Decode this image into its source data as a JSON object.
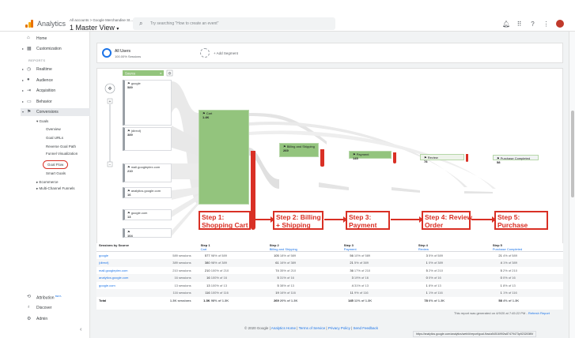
{
  "header": {
    "app_name": "Analytics",
    "breadcrumb": "All accounts > Google Merchandise St...",
    "view": "1 Master View",
    "search_placeholder": "Try searching \"How to create an event\"",
    "brand_colors": [
      "#f9ab00",
      "#e37400",
      "#e8710a"
    ]
  },
  "sidebar": {
    "home": "Home",
    "customization": "Customization",
    "reports_heading": "REPORTS",
    "realtime": "Realtime",
    "audience": "Audience",
    "acquisition": "Acquisition",
    "behavior": "Behavior",
    "conversions": "Conversions",
    "goals": "Goals",
    "goal_items": [
      "Overview",
      "Goal URLs",
      "Reverse Goal Path",
      "Funnel Visualization",
      "Goal Flow",
      "Smart Goals"
    ],
    "ecommerce": "Ecommerce",
    "multichannel": "Multi-Channel Funnels",
    "attribution": "Attribution",
    "attribution_badge": "BETA",
    "discover": "Discover",
    "admin": "Admin"
  },
  "segments": {
    "current_title": "All Users",
    "current_sub": "100.00% Sessions",
    "add_label": "+ Add Segment"
  },
  "flow": {
    "dropdown": "Source",
    "sources": [
      {
        "name": "google",
        "value": "589"
      },
      {
        "name": "(direct)",
        "value": "389"
      },
      {
        "name": "mall.googleplex.com",
        "value": "210"
      },
      {
        "name": "analytics.google.com",
        "value": "16"
      },
      {
        "name": "google.com",
        "value": "13"
      },
      {
        "name": "",
        "value": "104"
      }
    ],
    "nodes": [
      {
        "name": "Cart",
        "value": "1.4K"
      },
      {
        "name": "Billing and Shipping",
        "value": "269"
      },
      {
        "name": "Payment",
        "value": "145"
      },
      {
        "name": "Review",
        "value": "78"
      },
      {
        "name": "Purchase Completed",
        "value": "58"
      }
    ],
    "annotations": [
      "Step 1:\nShopping Cart",
      "Step 2: Billing\n+ Shipping",
      "Step 3:\nPayment",
      "Step 4: Review\nOrder",
      "Step 5:\nPurchase"
    ],
    "green": "#93c47d",
    "red": "#d93025"
  },
  "table": {
    "source_header": "Sessions by Source",
    "steps": [
      {
        "step": "Step 1",
        "name": "Cart"
      },
      {
        "step": "Step 2",
        "name": "Billing and Shipping"
      },
      {
        "step": "Step 3",
        "name": "Payment"
      },
      {
        "step": "Step 4",
        "name": "Review"
      },
      {
        "step": "Step 5",
        "name": "Purchase Completed"
      }
    ],
    "rows": [
      {
        "source": "google",
        "sessions": "589 sessions",
        "cells": [
          [
            "577",
            "98% of 589"
          ],
          [
            "105",
            "18% of 589"
          ],
          [
            "56",
            "10% of 589"
          ],
          [
            "3",
            "5% of 589"
          ],
          [
            "21",
            "4% of 589"
          ]
        ]
      },
      {
        "source": "(direct)",
        "sessions": "389 sessions",
        "cells": [
          [
            "380",
            "98% of 389"
          ],
          [
            "61",
            "16% of 389"
          ],
          [
            "21",
            "5% of 389"
          ],
          [
            "1",
            "0% of 389"
          ],
          [
            "4",
            "1% of 389"
          ]
        ]
      },
      {
        "source": "mall.googleplex.com",
        "sessions": "210 sessions",
        "cells": [
          [
            "210",
            "100% of 210"
          ],
          [
            "74",
            "35% of 210"
          ],
          [
            "36",
            "17% of 210"
          ],
          [
            "5",
            "2% of 210"
          ],
          [
            "5",
            "2% of 210"
          ]
        ]
      },
      {
        "source": "analytics.google.com",
        "sessions": "16 sessions",
        "cells": [
          [
            "16",
            "100% of 16"
          ],
          [
            "5",
            "31% of 16"
          ],
          [
            "3",
            "19% of 16"
          ],
          [
            "0",
            "0% of 16"
          ],
          [
            "0",
            "0% of 16"
          ]
        ]
      },
      {
        "source": "google.com",
        "sessions": "13 sessions",
        "cells": [
          [
            "13",
            "100% of 13"
          ],
          [
            "5",
            "38% of 13"
          ],
          [
            "4",
            "31% of 13"
          ],
          [
            "1",
            "8% of 13"
          ],
          [
            "1",
            "8% of 13"
          ]
        ]
      },
      {
        "source": "",
        "sessions": "116 sessions",
        "cells": [
          [
            "116",
            "100% of 116"
          ],
          [
            "19",
            "16% of 116"
          ],
          [
            "11",
            "9% of 116"
          ],
          [
            "1",
            "1% of 116"
          ],
          [
            "1",
            "1% of 116"
          ]
        ]
      }
    ],
    "total": {
      "label": "Total",
      "sessions": "1.3K sessions",
      "cells": [
        [
          "1.3K",
          "98% of 1.3K"
        ],
        [
          "269",
          "20% of 1.3K"
        ],
        [
          "145",
          "11% of 1.3K"
        ],
        [
          "78",
          "6% of 1.3K"
        ],
        [
          "58",
          "4% of 1.3K"
        ]
      ]
    }
  },
  "footnote": {
    "text": "This report was generated on 4/9/20 at 7:45:22 PM -",
    "link": "Refresh Report"
  },
  "footer": {
    "copyright": "© 2020 Google |",
    "links": [
      "Analytics Home",
      "Terms of Service",
      "Privacy Policy",
      "Send Feedback"
    ]
  },
  "status_url": "https://analytics.google.com/analytics/web/#/report/goal-flow/a54516992w87479473p92320089/"
}
